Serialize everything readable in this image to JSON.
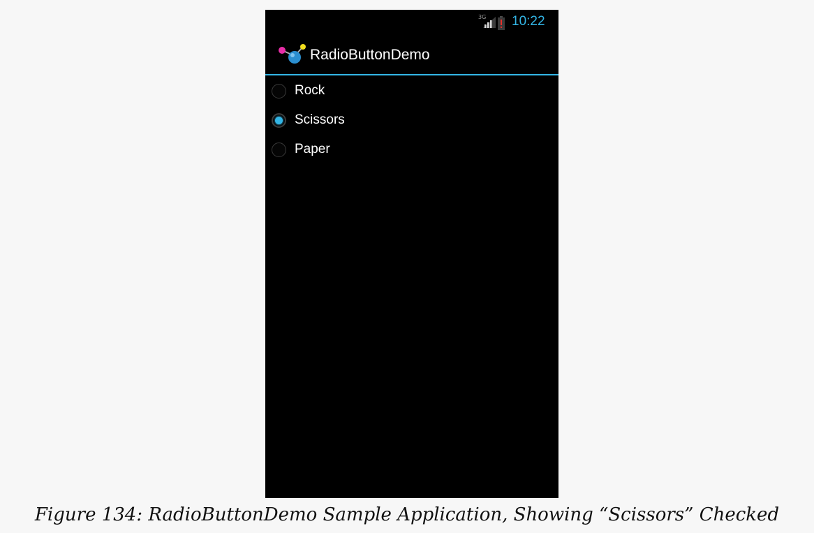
{
  "status_bar": {
    "network_label": "3G",
    "time": "10:22",
    "signal_icon": "signal-icon",
    "battery_icon": "battery-low-icon",
    "accent_color": "#33b5e5"
  },
  "action_bar": {
    "app_icon": "app-launcher-icon",
    "title": "RadioButtonDemo"
  },
  "radio_group": {
    "items": [
      {
        "label": "Rock",
        "checked": false
      },
      {
        "label": "Scissors",
        "checked": true
      },
      {
        "label": "Paper",
        "checked": false
      }
    ]
  },
  "caption": "Figure 134: RadioButtonDemo Sample Application, Showing “Scissors” Checked"
}
